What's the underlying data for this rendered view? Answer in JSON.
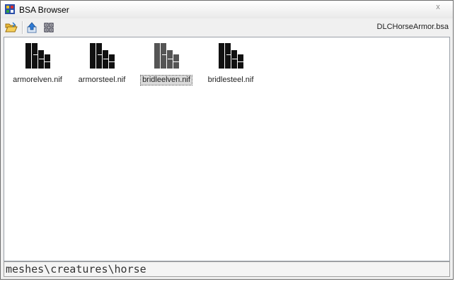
{
  "window": {
    "title": "BSA Browser"
  },
  "titlebar": {
    "app_icon": "bsa-app-icon",
    "close_glyph": "x"
  },
  "toolbar": {
    "open_icon": "open-folder-icon",
    "up_icon": "up-folder-icon",
    "view_icon": "view-grid-icon",
    "archive_name": "DLCHorseArmor.bsa"
  },
  "files": [
    {
      "name": "armorelven.nif",
      "icon": "nif-file-icon",
      "selected": false
    },
    {
      "name": "armorsteel.nif",
      "icon": "nif-file-icon",
      "selected": false
    },
    {
      "name": "bridleelven.nif",
      "icon": "nif-file-icon",
      "selected": true
    },
    {
      "name": "bridlesteel.nif",
      "icon": "nif-file-icon",
      "selected": false
    }
  ],
  "path_bar": {
    "path": "meshes\\creatures\\horse"
  },
  "colors": {
    "icon": "#111111",
    "icon_selected": "#555555",
    "border": "#9aa0a8"
  }
}
